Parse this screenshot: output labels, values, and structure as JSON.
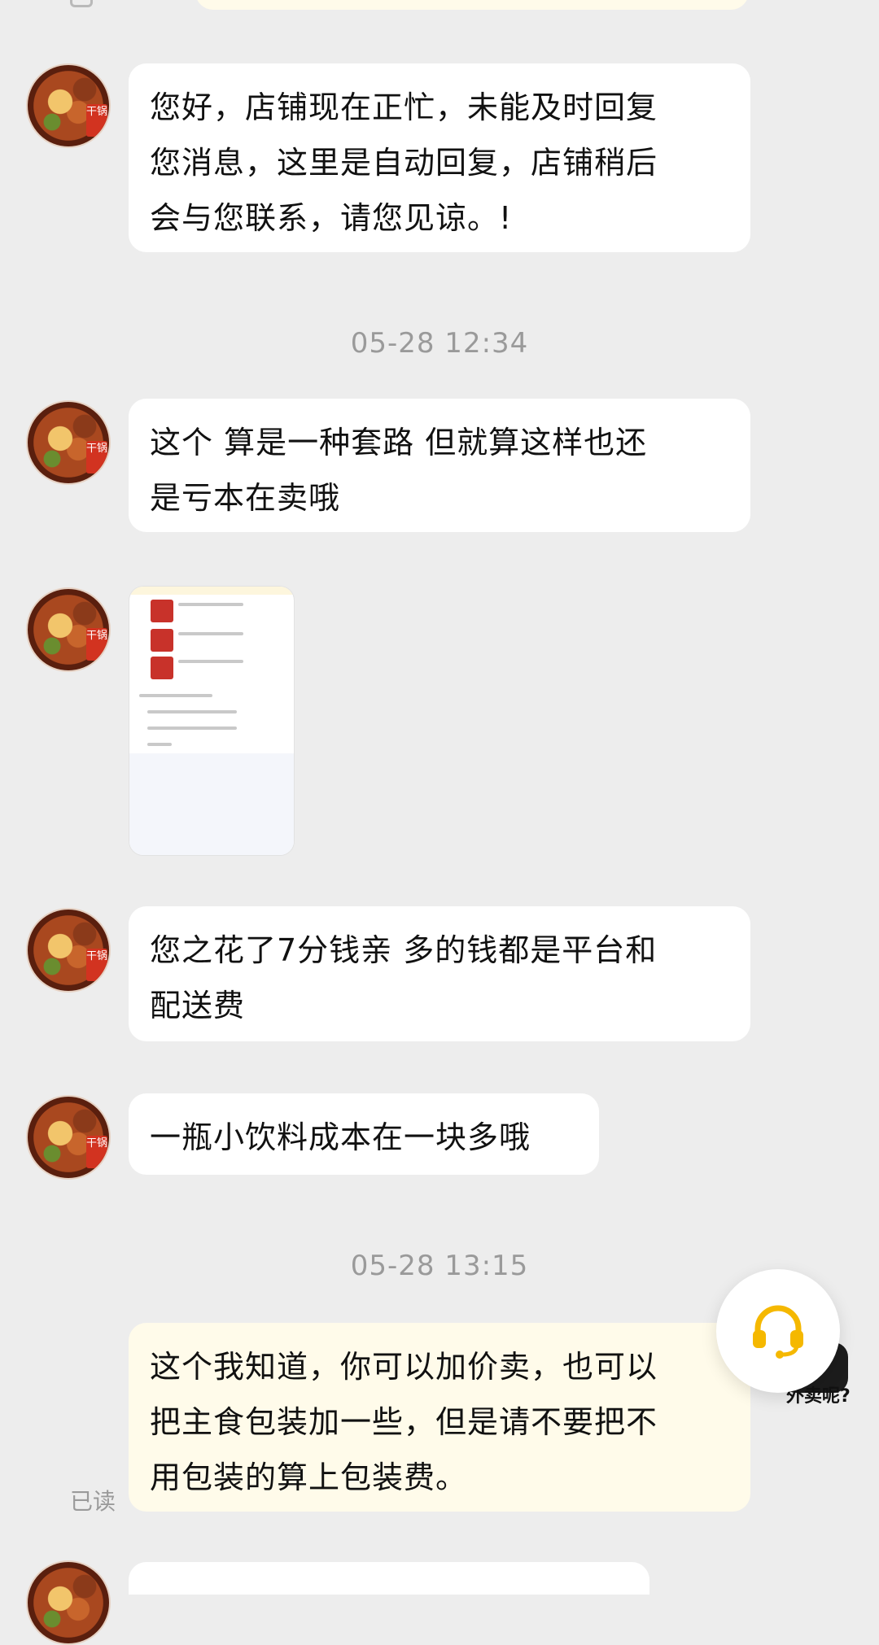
{
  "messages": [
    {
      "text": "您好，店铺现在正忙，未能及时回复\n您消息，这里是自动回复，店铺稍后\n会与您联系，请您见谅。!"
    },
    {
      "text": "这个 算是一种套路 但就算这样也还\n是亏本在卖哦"
    },
    {
      "text": "您之花了7分钱亲 多的钱都是平台和\n配送费"
    },
    {
      "text": "一瓶小饮料成本在一块多哦"
    },
    {
      "text": "这个我知道，你可以加价卖，也可以\n把主食包装加一些，但是请不要把不\n用包装的算上包装费。"
    }
  ],
  "timestamps": [
    "05-28 12:34",
    "05-28 13:15"
  ],
  "read_status": "已读",
  "avatar_tag": "干锅",
  "support_peek_text": "外卖呢?",
  "colors": {
    "background": "#ededed",
    "incoming_bubble": "#ffffff",
    "outgoing_bubble": "#fffbea",
    "support_icon": "#f5b800",
    "timestamp_text": "#9a9a9a"
  },
  "icons": {
    "support": "headset-icon"
  }
}
